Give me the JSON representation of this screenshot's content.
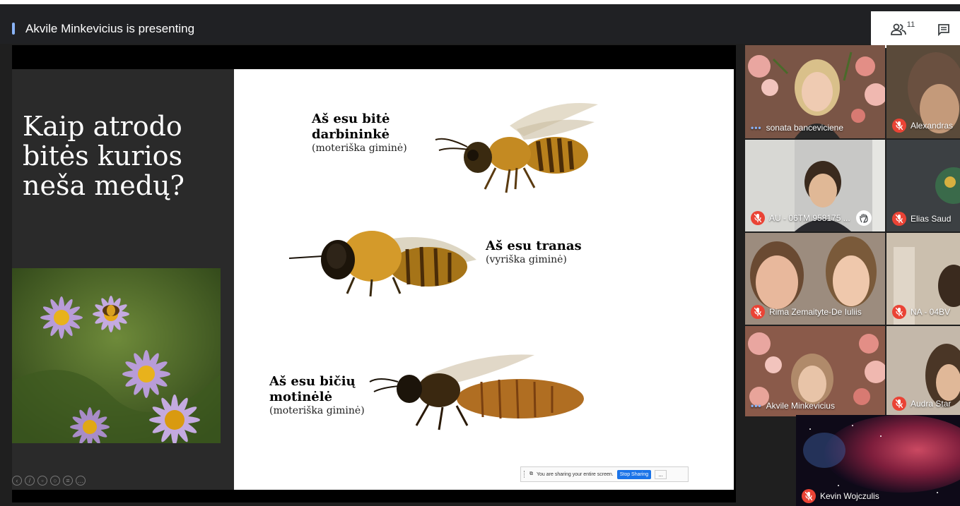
{
  "header": {
    "presenting_text": "Akvile Minkevicius is presenting",
    "people_count": "11",
    "people_icon": "people-icon",
    "chat_icon": "chat-icon"
  },
  "slide": {
    "title": "Kaip atrodo bitės kurios neša medų?",
    "bees": [
      {
        "name": "Aš esu bitė darbininkė",
        "line1": "Aš esu bitė",
        "line2": "darbininkė",
        "gender": "(moteriška giminė)"
      },
      {
        "name": "Aš esu tranas",
        "line1": "Aš esu tranas",
        "gender": "(vyriška giminė)"
      },
      {
        "name": "Aš esu bičių motinėlė",
        "line1": "Aš esu bičių",
        "line2": "motinėlė",
        "gender": "(moteriška giminė)"
      }
    ]
  },
  "share_bar": {
    "text": "You are sharing your entire screen.",
    "stop_label": "Stop Sharing",
    "more_label": "..."
  },
  "participants": [
    {
      "name": "sonata banceviciene",
      "status": "talking"
    },
    {
      "name": "Alexandras",
      "status": "muted"
    },
    {
      "name": "AU - 06TM 958175 ...",
      "status": "muted",
      "hand": true
    },
    {
      "name": "Elias Saud",
      "status": "muted"
    },
    {
      "name": "Rima Zemaityte-De Iuliis",
      "status": "muted"
    },
    {
      "name": "NA - 04BV",
      "status": "muted"
    },
    {
      "name": "Akvile Minkevicius",
      "status": "talking"
    },
    {
      "name": "Audra Star",
      "status": "muted"
    },
    {
      "name": "Kevin Wojczulis",
      "status": "muted"
    }
  ],
  "colors": {
    "mic_off": "#ea4335",
    "accent": "#1a73e8",
    "talking": "#8ab4f8"
  }
}
